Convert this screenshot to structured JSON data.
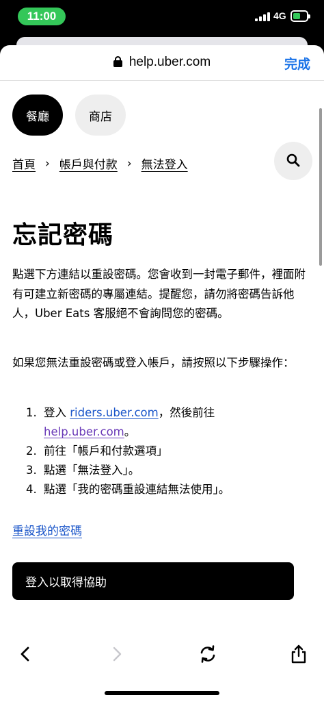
{
  "status_bar": {
    "time": "11:00",
    "network": "4G"
  },
  "browser": {
    "url": "help.uber.com",
    "done_label": "完成"
  },
  "segments": [
    {
      "label": "餐廳",
      "selected": true
    },
    {
      "label": "商店",
      "selected": false
    }
  ],
  "breadcrumb": [
    "首頁",
    "帳戶與付款",
    "無法登入"
  ],
  "breadcrumb_separator": "›",
  "article": {
    "title": "忘記密碼",
    "paragraph1": "點選下方連結以重設密碼。您會收到一封電子郵件，裡面附有可建立新密碼的專屬連結。提醒您，請勿將密碼告訴他人，Uber Eats 客服絕不會詢問您的密碼。",
    "paragraph2": "如果您無法重設密碼或登入帳戶，請按照以下步驟操作：",
    "steps": [
      {
        "num": "1.",
        "pre": "登入 ",
        "link1": "riders.uber.com",
        "mid": "，然後前往",
        "link2": "help.uber.com",
        "post": "。"
      },
      {
        "num": "2.",
        "text": "前往「帳戶和付款選項」"
      },
      {
        "num": "3.",
        "text": "點選「無法登入」。"
      },
      {
        "num": "4.",
        "text": "點選「我的密碼重設連結無法使用」。"
      }
    ],
    "reset_link": "重設我的密碼",
    "login_button": "登入以取得協助"
  },
  "colors": {
    "link": "#1a55c9",
    "visited_link": "#6a3ab8",
    "accent": "#1a73e8",
    "time_pill": "#34c759"
  },
  "icons": {
    "lock": "lock-icon",
    "search": "search-icon",
    "back": "chevron-left-icon",
    "forward": "chevron-right-icon",
    "refresh": "refresh-icon",
    "share": "share-icon"
  }
}
